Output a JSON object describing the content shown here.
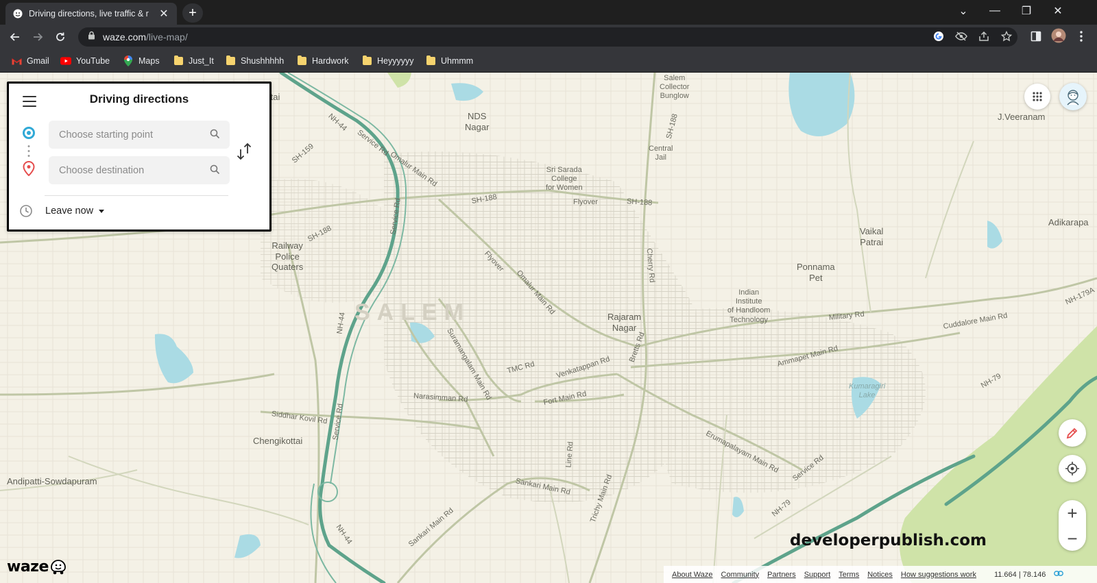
{
  "browser": {
    "tab_title": "Driving directions, live traffic & r",
    "new_tab_label": "+",
    "window_controls": {
      "minimize": "—",
      "restore": "❐",
      "close": "✕",
      "tab_list": "⌄"
    },
    "url_host": "waze.com",
    "url_path": "/live-map/",
    "bookmarks": [
      {
        "label": "Gmail",
        "icon": "gmail-icon"
      },
      {
        "label": "YouTube",
        "icon": "youtube-icon"
      },
      {
        "label": "Maps",
        "icon": "maps-icon"
      },
      {
        "label": "Just_It",
        "icon": "folder-icon"
      },
      {
        "label": "Shushhhhh",
        "icon": "folder-icon"
      },
      {
        "label": "Hardwork",
        "icon": "folder-icon"
      },
      {
        "label": "Heyyyyyy",
        "icon": "folder-icon"
      },
      {
        "label": "Uhmmm",
        "icon": "folder-icon"
      }
    ]
  },
  "panel": {
    "title": "Driving directions",
    "start_placeholder": "Choose starting point",
    "destination_placeholder": "Choose destination",
    "leave_label": "Leave now"
  },
  "map": {
    "city": "SALEM",
    "labels": [
      {
        "text": "NDS\nNagar"
      },
      {
        "text": "Salem\nCollector\nBunglow"
      },
      {
        "text": "Central\nJail"
      },
      {
        "text": "Sri Sarada\nCollege\nfor Women"
      },
      {
        "text": "J.Veeranam"
      },
      {
        "text": "Adikarapa"
      },
      {
        "text": "Vaikal\nPatrai"
      },
      {
        "text": "Ponnama\nPet"
      },
      {
        "text": "Railway\nPolice\nQuaters"
      },
      {
        "text": "Indian\nInstitute\nof Handloom\nTechnology"
      },
      {
        "text": "Rajaram\nNagar"
      },
      {
        "text": "Chengikottai"
      },
      {
        "text": "Andipatti-Sowdapuram"
      },
      {
        "text": "Kumaragiri\nLake"
      },
      {
        "text": "ttai"
      }
    ],
    "roads": [
      {
        "text": "NH-44"
      },
      {
        "text": "Service Rd"
      },
      {
        "text": "Omalur Main Rd"
      },
      {
        "text": "SH-159"
      },
      {
        "text": "SH-188"
      },
      {
        "text": "SH-188"
      },
      {
        "text": "Flyover"
      },
      {
        "text": "SH-188"
      },
      {
        "text": "SH-188"
      },
      {
        "text": "Flyover"
      },
      {
        "text": "Omalur Main Rd"
      },
      {
        "text": "Cherry Rd"
      },
      {
        "text": "Military Rd"
      },
      {
        "text": "Cuddalore Main Rd"
      },
      {
        "text": "NH-179A"
      },
      {
        "text": "Ammapet Main Rd"
      },
      {
        "text": "NH-79"
      },
      {
        "text": "Venkatappan Rd"
      },
      {
        "text": "Bretts Rd"
      },
      {
        "text": "Suramangalam Main Rd"
      },
      {
        "text": "TMC Rd"
      },
      {
        "text": "Fort Main Rd"
      },
      {
        "text": "Narasimman Rd"
      },
      {
        "text": "Siddhar Kovil Rd"
      },
      {
        "text": "NH-44"
      },
      {
        "text": "Service Rd"
      },
      {
        "text": "Erumapalayam Main Rd"
      },
      {
        "text": "Service Rd"
      },
      {
        "text": "NH-79"
      },
      {
        "text": "Sankari Main Rd"
      },
      {
        "text": "Sankari Main Rd"
      },
      {
        "text": "Trichy Main Rd"
      },
      {
        "text": "Line Rd"
      },
      {
        "text": "NH-44"
      },
      {
        "text": "Service Rd"
      }
    ]
  },
  "footer": {
    "links": [
      "About Waze",
      "Community",
      "Partners",
      "Support",
      "Terms",
      "Notices",
      "How suggestions work"
    ],
    "coords": "11.664 | 78.146"
  },
  "logo_text": "waze",
  "watermark": "developerpublish.com",
  "zoom": {
    "in": "+",
    "out": "−"
  }
}
